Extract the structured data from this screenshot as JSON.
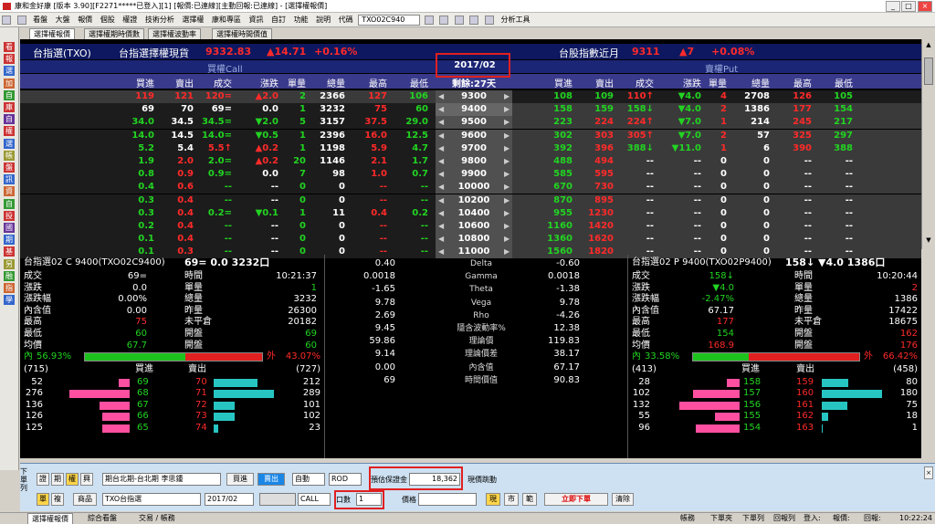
{
  "window": {
    "title": "康和金好康 [版本 3.90][F2271*****已登入][1] [報價:已連線][主動回報:已連線] - [選擇權報價]"
  },
  "menu": {
    "items": [
      "看盤",
      "大盤",
      "報價",
      "個股",
      "權證",
      "技術分析",
      "選擇權",
      "康和專區",
      "資訊",
      "自訂",
      "功能",
      "說明"
    ],
    "code_label": "代碼",
    "code_value": "TXO02C940",
    "extra": "分析工具"
  },
  "leftbar": {
    "items": [
      "看",
      "報",
      "選",
      "加",
      "自",
      "庫",
      "自",
      "權",
      "選",
      "帳",
      "盤",
      "訊",
      "資",
      "自",
      "投",
      "國",
      "期",
      "基",
      "另",
      "融",
      "指",
      "學"
    ]
  },
  "tabs": [
    "選擇權報價",
    "選擇權期時價數",
    "選擇權波動率",
    "選擇權時間價值"
  ],
  "header": {
    "left_name": "台指選(TXO)",
    "left_underlying": "台指選擇權現貨",
    "left_price": "9332.83",
    "left_change": "▲14.71",
    "left_pct": "+0.16%",
    "right_name": "台股指數近月",
    "right_price": "9311",
    "right_change": "▲7",
    "right_pct": "+0.08%",
    "call_label": "買權Call",
    "put_label": "賣權Put",
    "month": "2017/02",
    "remaining": "剩餘:27天"
  },
  "columns": {
    "call": [
      "買進",
      "賣出",
      "成交",
      "漲跌",
      "單量",
      "總量",
      "最高",
      "最低"
    ],
    "put": [
      "買進",
      "賣出",
      "成交",
      "漲跌",
      "單量",
      "總量",
      "最高",
      "最低"
    ]
  },
  "chain": [
    {
      "strike": "9300",
      "c": [
        "119",
        "121",
        "120=",
        "▲2.0",
        "2",
        "2366",
        "127",
        "106"
      ],
      "p": [
        "108",
        "109",
        "110↑",
        "▼4.0",
        "4",
        "2708",
        "126",
        "105"
      ]
    },
    {
      "strike": "9400",
      "c": [
        "69",
        "70",
        "69=",
        "0.0",
        "1",
        "3232",
        "75",
        "60"
      ],
      "p": [
        "158",
        "159",
        "158↓",
        "▼4.0",
        "2",
        "1386",
        "177",
        "154"
      ]
    },
    {
      "strike": "9500",
      "c": [
        "34.0",
        "34.5",
        "34.5=",
        "▼2.0",
        "5",
        "3157",
        "37.5",
        "29.0"
      ],
      "p": [
        "223",
        "224",
        "224↑",
        "▼7.0",
        "1",
        "214",
        "245",
        "217"
      ]
    },
    {
      "strike": "9600",
      "c": [
        "14.0",
        "14.5",
        "14.0=",
        "▼0.5",
        "1",
        "2396",
        "16.0",
        "12.5"
      ],
      "p": [
        "302",
        "303",
        "305↑",
        "▼7.0",
        "2",
        "57",
        "325",
        "297"
      ]
    },
    {
      "strike": "9700",
      "c": [
        "5.2",
        "5.4",
        "5.5↑",
        "▲0.2",
        "1",
        "1198",
        "5.9",
        "4.7"
      ],
      "p": [
        "392",
        "396",
        "388↓",
        "▼11.0",
        "1",
        "6",
        "390",
        "388"
      ]
    },
    {
      "strike": "9800",
      "c": [
        "1.9",
        "2.0",
        "2.0=",
        "▲0.2",
        "20",
        "1146",
        "2.1",
        "1.7"
      ],
      "p": [
        "488",
        "494",
        "--",
        "--",
        "0",
        "0",
        "--",
        "--"
      ]
    },
    {
      "strike": "9900",
      "c": [
        "0.8",
        "0.9",
        "0.9=",
        "0.0",
        "7",
        "98",
        "1.0",
        "0.7"
      ],
      "p": [
        "585",
        "595",
        "--",
        "--",
        "0",
        "0",
        "--",
        "--"
      ]
    },
    {
      "strike": "10000",
      "c": [
        "0.4",
        "0.6",
        "--",
        "--",
        "0",
        "0",
        "--",
        "--"
      ],
      "p": [
        "670",
        "730",
        "--",
        "--",
        "0",
        "0",
        "--",
        "--"
      ]
    },
    {
      "strike": "10200",
      "c": [
        "0.3",
        "0.4",
        "--",
        "--",
        "0",
        "0",
        "--",
        "--"
      ],
      "p": [
        "870",
        "895",
        "--",
        "--",
        "0",
        "0",
        "--",
        "--"
      ]
    },
    {
      "strike": "10400",
      "c": [
        "0.3",
        "0.4",
        "0.2=",
        "▼0.1",
        "1",
        "11",
        "0.4",
        "0.2"
      ],
      "p": [
        "955",
        "1230",
        "--",
        "--",
        "0",
        "0",
        "--",
        "--"
      ]
    },
    {
      "strike": "10600",
      "c": [
        "0.2",
        "0.4",
        "--",
        "--",
        "0",
        "0",
        "--",
        "--"
      ],
      "p": [
        "1160",
        "1420",
        "--",
        "--",
        "0",
        "0",
        "--",
        "--"
      ]
    },
    {
      "strike": "10800",
      "c": [
        "0.1",
        "0.4",
        "--",
        "--",
        "0",
        "0",
        "--",
        "--"
      ],
      "p": [
        "1360",
        "1620",
        "--",
        "--",
        "0",
        "0",
        "--",
        "--"
      ]
    },
    {
      "strike": "11000",
      "c": [
        "0.1",
        "0.3",
        "--",
        "--",
        "0",
        "0",
        "--",
        "--"
      ],
      "p": [
        "1560",
        "1820",
        "--",
        "--",
        "0",
        "0",
        "--",
        "--"
      ]
    }
  ],
  "call_detail": {
    "title": "台指選02 C 9400(TXO02C9400)",
    "quote": "69= 0.0 3232口",
    "rows": [
      [
        "成交",
        "69=",
        "時間",
        "10:21:37"
      ],
      [
        "漲跌",
        "0.0",
        "單量",
        "1"
      ],
      [
        "漲跌幅",
        "0.00%",
        "總量",
        "3232"
      ],
      [
        "內含值",
        "0.00",
        "昨量",
        "26300"
      ],
      [
        "最高",
        "75",
        "未平倉",
        "20182"
      ],
      [
        "最低",
        "60",
        "開盤",
        "69"
      ],
      [
        "均價",
        "67.7",
        "開盤",
        "60"
      ]
    ],
    "in_label": "內",
    "in_pct": "56.93%",
    "out_label": "外",
    "out_pct": "43.07%",
    "in_fraction": 0.5693,
    "bid_total": "(715)",
    "ask_total": "(727)",
    "bid_label": "買進",
    "ask_label": "賣出",
    "book": [
      [
        "52",
        "69",
        "70",
        "212"
      ],
      [
        "276",
        "68",
        "71",
        "289"
      ],
      [
        "136",
        "67",
        "72",
        "101"
      ],
      [
        "126",
        "66",
        "73",
        "102"
      ],
      [
        "125",
        "65",
        "74",
        "23"
      ]
    ]
  },
  "greeks": {
    "rows": [
      [
        "0.40",
        "Delta",
        "-0.60"
      ],
      [
        "0.0018",
        "Gamma",
        "0.0018"
      ],
      [
        "-1.65",
        "Theta",
        "-1.38"
      ],
      [
        "9.78",
        "Vega",
        "9.78"
      ],
      [
        "2.69",
        "Rho",
        "-4.26"
      ],
      [
        "9.45",
        "隱含波動率%",
        "12.38"
      ],
      [
        "59.86",
        "理論價",
        "119.83"
      ],
      [
        "9.14",
        "理論價差",
        "38.17"
      ],
      [
        "0.00",
        "內含值",
        "67.17"
      ],
      [
        "69",
        "時間價值",
        "90.83"
      ]
    ]
  },
  "put_detail": {
    "title": "台指選02 P 9400(TXO02P9400)",
    "quote": "158↓ ▼4.0 1386口",
    "rows": [
      [
        "成交",
        "158↓",
        "時間",
        "10:20:44"
      ],
      [
        "漲跌",
        "▼4.0",
        "單量",
        "2"
      ],
      [
        "漲跌幅",
        "-2.47%",
        "總量",
        "1386"
      ],
      [
        "內含值",
        "67.17",
        "昨量",
        "17422"
      ],
      [
        "最高",
        "177",
        "未平倉",
        "18675"
      ],
      [
        "最低",
        "154",
        "開盤",
        "162"
      ],
      [
        "均價",
        "168.9",
        "開盤",
        "176"
      ]
    ],
    "in_label": "內",
    "in_pct": "33.58%",
    "out_label": "外",
    "out_pct": "66.42%",
    "in_fraction": 0.3358,
    "bid_total": "(413)",
    "ask_total": "(458)",
    "bid_label": "買進",
    "ask_label": "賣出",
    "book": [
      [
        "28",
        "158",
        "159",
        "80"
      ],
      [
        "102",
        "157",
        "160",
        "180"
      ],
      [
        "132",
        "156",
        "161",
        "75"
      ],
      [
        "55",
        "155",
        "162",
        "18"
      ],
      [
        "96",
        "154",
        "163",
        "1"
      ]
    ]
  },
  "order": {
    "side_label": "下單列",
    "type_buttons": [
      "證",
      "期",
      "權",
      "興"
    ],
    "account": "期台北期-台北期",
    "account_user": "李思鍾",
    "buy_label": "買進",
    "sell_label": "賣出",
    "auto_select": "自動",
    "rod_select": "ROD",
    "margin_label": "預估保證金",
    "margin_value": "18,362",
    "price_follow_label": "現價跳動",
    "mode_buttons": [
      "單",
      "複"
    ],
    "product_label": "商品",
    "product_value": "TXO台指選",
    "month_value": "2017/02",
    "cp_value": "CALL",
    "qty_label": "口數",
    "qty_value": "1",
    "price_label": "價格",
    "price_value": "",
    "current_btn": "現",
    "market_btn": "市",
    "range_btn": "範",
    "submit_label": "立即下單",
    "clear_label": "清除"
  },
  "bottom_tabs": [
    "選擇權報價",
    "綜合看盤",
    "交易 / 帳務"
  ],
  "status": {
    "items": [
      "帳務",
      "下單夾",
      "下單列",
      "回報列",
      "登入:",
      "報價:",
      "回報:"
    ],
    "time": "10:22:24"
  },
  "colors": {
    "up": "#ff2a2a",
    "down": "#22d422",
    "header_bg": "#0e1860",
    "highlight": "#e02020"
  }
}
